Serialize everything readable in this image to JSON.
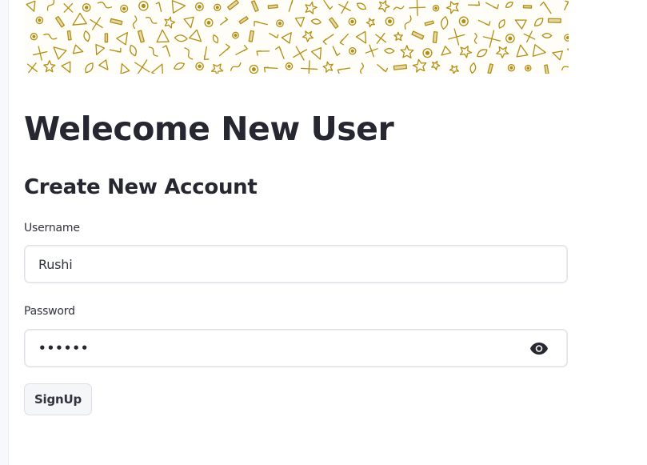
{
  "banner": {
    "icon_name": "doodle-pattern-banner",
    "ink_color": "#b28e12",
    "paper_color": "#fffdf7"
  },
  "header": {
    "title": "Welecome New User",
    "subtitle": "Create New Account"
  },
  "form": {
    "username": {
      "label": "Username",
      "value": "Rushi"
    },
    "password": {
      "label": "Password",
      "masked_value": "••••••",
      "toggle_icon": "eye-icon"
    },
    "submit_label": "SignUp"
  },
  "colors": {
    "text": "#262730",
    "input_border": "#e0e2e8",
    "button_bg": "#f5f6f8"
  }
}
